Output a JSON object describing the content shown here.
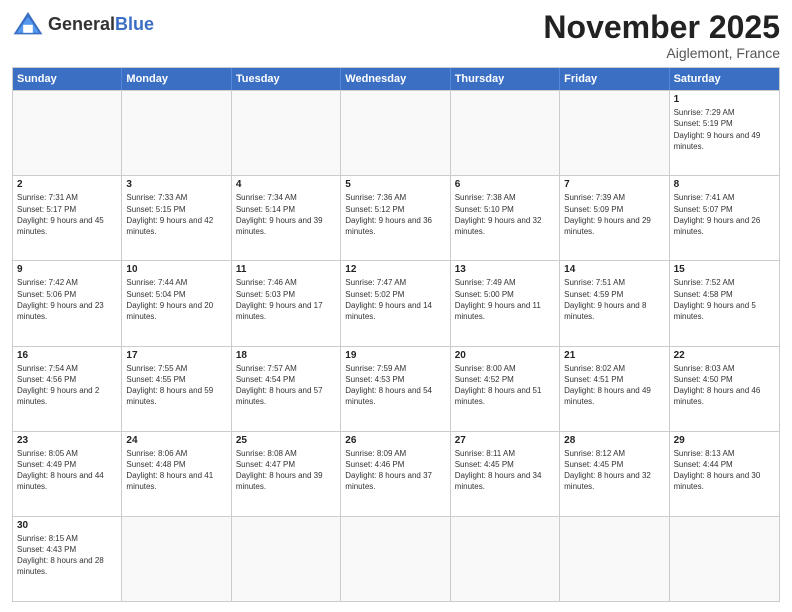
{
  "header": {
    "logo_general": "General",
    "logo_blue": "Blue",
    "month": "November 2025",
    "location": "Aiglemont, France"
  },
  "days": [
    "Sunday",
    "Monday",
    "Tuesday",
    "Wednesday",
    "Thursday",
    "Friday",
    "Saturday"
  ],
  "weeks": [
    [
      {
        "date": "",
        "info": ""
      },
      {
        "date": "",
        "info": ""
      },
      {
        "date": "",
        "info": ""
      },
      {
        "date": "",
        "info": ""
      },
      {
        "date": "",
        "info": ""
      },
      {
        "date": "",
        "info": ""
      },
      {
        "date": "1",
        "info": "Sunrise: 7:29 AM\nSunset: 5:19 PM\nDaylight: 9 hours and 49 minutes."
      }
    ],
    [
      {
        "date": "2",
        "info": "Sunrise: 7:31 AM\nSunset: 5:17 PM\nDaylight: 9 hours and 45 minutes."
      },
      {
        "date": "3",
        "info": "Sunrise: 7:33 AM\nSunset: 5:15 PM\nDaylight: 9 hours and 42 minutes."
      },
      {
        "date": "4",
        "info": "Sunrise: 7:34 AM\nSunset: 5:14 PM\nDaylight: 9 hours and 39 minutes."
      },
      {
        "date": "5",
        "info": "Sunrise: 7:36 AM\nSunset: 5:12 PM\nDaylight: 9 hours and 36 minutes."
      },
      {
        "date": "6",
        "info": "Sunrise: 7:38 AM\nSunset: 5:10 PM\nDaylight: 9 hours and 32 minutes."
      },
      {
        "date": "7",
        "info": "Sunrise: 7:39 AM\nSunset: 5:09 PM\nDaylight: 9 hours and 29 minutes."
      },
      {
        "date": "8",
        "info": "Sunrise: 7:41 AM\nSunset: 5:07 PM\nDaylight: 9 hours and 26 minutes."
      }
    ],
    [
      {
        "date": "9",
        "info": "Sunrise: 7:42 AM\nSunset: 5:06 PM\nDaylight: 9 hours and 23 minutes."
      },
      {
        "date": "10",
        "info": "Sunrise: 7:44 AM\nSunset: 5:04 PM\nDaylight: 9 hours and 20 minutes."
      },
      {
        "date": "11",
        "info": "Sunrise: 7:46 AM\nSunset: 5:03 PM\nDaylight: 9 hours and 17 minutes."
      },
      {
        "date": "12",
        "info": "Sunrise: 7:47 AM\nSunset: 5:02 PM\nDaylight: 9 hours and 14 minutes."
      },
      {
        "date": "13",
        "info": "Sunrise: 7:49 AM\nSunset: 5:00 PM\nDaylight: 9 hours and 11 minutes."
      },
      {
        "date": "14",
        "info": "Sunrise: 7:51 AM\nSunset: 4:59 PM\nDaylight: 9 hours and 8 minutes."
      },
      {
        "date": "15",
        "info": "Sunrise: 7:52 AM\nSunset: 4:58 PM\nDaylight: 9 hours and 5 minutes."
      }
    ],
    [
      {
        "date": "16",
        "info": "Sunrise: 7:54 AM\nSunset: 4:56 PM\nDaylight: 9 hours and 2 minutes."
      },
      {
        "date": "17",
        "info": "Sunrise: 7:55 AM\nSunset: 4:55 PM\nDaylight: 8 hours and 59 minutes."
      },
      {
        "date": "18",
        "info": "Sunrise: 7:57 AM\nSunset: 4:54 PM\nDaylight: 8 hours and 57 minutes."
      },
      {
        "date": "19",
        "info": "Sunrise: 7:59 AM\nSunset: 4:53 PM\nDaylight: 8 hours and 54 minutes."
      },
      {
        "date": "20",
        "info": "Sunrise: 8:00 AM\nSunset: 4:52 PM\nDaylight: 8 hours and 51 minutes."
      },
      {
        "date": "21",
        "info": "Sunrise: 8:02 AM\nSunset: 4:51 PM\nDaylight: 8 hours and 49 minutes."
      },
      {
        "date": "22",
        "info": "Sunrise: 8:03 AM\nSunset: 4:50 PM\nDaylight: 8 hours and 46 minutes."
      }
    ],
    [
      {
        "date": "23",
        "info": "Sunrise: 8:05 AM\nSunset: 4:49 PM\nDaylight: 8 hours and 44 minutes."
      },
      {
        "date": "24",
        "info": "Sunrise: 8:06 AM\nSunset: 4:48 PM\nDaylight: 8 hours and 41 minutes."
      },
      {
        "date": "25",
        "info": "Sunrise: 8:08 AM\nSunset: 4:47 PM\nDaylight: 8 hours and 39 minutes."
      },
      {
        "date": "26",
        "info": "Sunrise: 8:09 AM\nSunset: 4:46 PM\nDaylight: 8 hours and 37 minutes."
      },
      {
        "date": "27",
        "info": "Sunrise: 8:11 AM\nSunset: 4:45 PM\nDaylight: 8 hours and 34 minutes."
      },
      {
        "date": "28",
        "info": "Sunrise: 8:12 AM\nSunset: 4:45 PM\nDaylight: 8 hours and 32 minutes."
      },
      {
        "date": "29",
        "info": "Sunrise: 8:13 AM\nSunset: 4:44 PM\nDaylight: 8 hours and 30 minutes."
      }
    ],
    [
      {
        "date": "30",
        "info": "Sunrise: 8:15 AM\nSunset: 4:43 PM\nDaylight: 8 hours and 28 minutes."
      },
      {
        "date": "",
        "info": ""
      },
      {
        "date": "",
        "info": ""
      },
      {
        "date": "",
        "info": ""
      },
      {
        "date": "",
        "info": ""
      },
      {
        "date": "",
        "info": ""
      },
      {
        "date": "",
        "info": ""
      }
    ]
  ]
}
